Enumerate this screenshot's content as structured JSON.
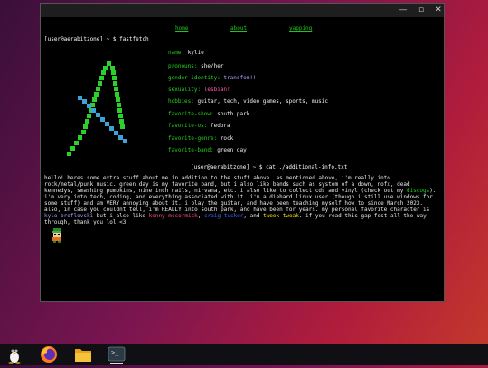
{
  "window": {
    "minimize_glyph": "—",
    "maximize_glyph": "▫",
    "close_glyph": "✕"
  },
  "nav": {
    "home": "home",
    "about": "about",
    "yapping": "yapping"
  },
  "prompt1": "[user@aerabitzone] ~ $ fastfetch",
  "info": [
    {
      "key": "name:",
      "value": "kylie"
    },
    {
      "key": "pronouns:",
      "value": "she/her"
    },
    {
      "key": "gender-identity:",
      "value": "transfem!!"
    },
    {
      "key": "sexuality:",
      "value": "lesbian!"
    },
    {
      "key": "hobbies:",
      "value": "guitar, tech, video games, sports, music"
    },
    {
      "key": "favorite-show:",
      "value": "south park"
    },
    {
      "key": "favorite-os:",
      "value": "fedora"
    },
    {
      "key": "favorite-genre:",
      "value": "rock"
    },
    {
      "key": "favorite-band:",
      "value": "green day"
    }
  ],
  "prompt2": "[user@aerabitzone] ~ $ cat ./additional-info.txt",
  "paragraph": {
    "p1": "hello! heres some extra stuff about me in addition to the stuff above. as mentioned above, i'm really into rock/metal/punk music. green day is my favorite band, but i also like bands such as system of a down, nofx, dead kennedys, smashing pumpkins, nine inch nails, nirvana, etc. i also like to collect cds and vinyl (check out my ",
    "link1": "discogs",
    "p2": "). i'm very into tech, coding, and everything associated with it. i'm a diehard linux user (though i still use windows for some stuff) and am VERY annoying about it. i play the guitar, and have been teaching myself how to since March 2023. also, in case you couldnt tell, i'm REALLY into south park, and have been for years. my personal favorite character is ",
    "kyle": "kyle broflovski",
    "p3": " but i also like ",
    "kenny": "kenny mccormick",
    "sep1": ", ",
    "craig": "craig tucker",
    "sep2": ", and ",
    "tweek": "tweek tweak",
    "p4": ". if you read this gap fest all the way through, thank you lol <3"
  },
  "colors": {
    "accent_green": "#21c21e",
    "logo_green": "#2bd12b",
    "logo_blue": "#3ba3d6",
    "terminal_bg": "#000000"
  },
  "taskbar": {
    "items": [
      {
        "icon": "tux-penguin-icon"
      },
      {
        "icon": "firefox-icon"
      },
      {
        "icon": "folder-icon"
      },
      {
        "icon": "terminal-icon",
        "label": ">_",
        "active": true
      }
    ]
  }
}
